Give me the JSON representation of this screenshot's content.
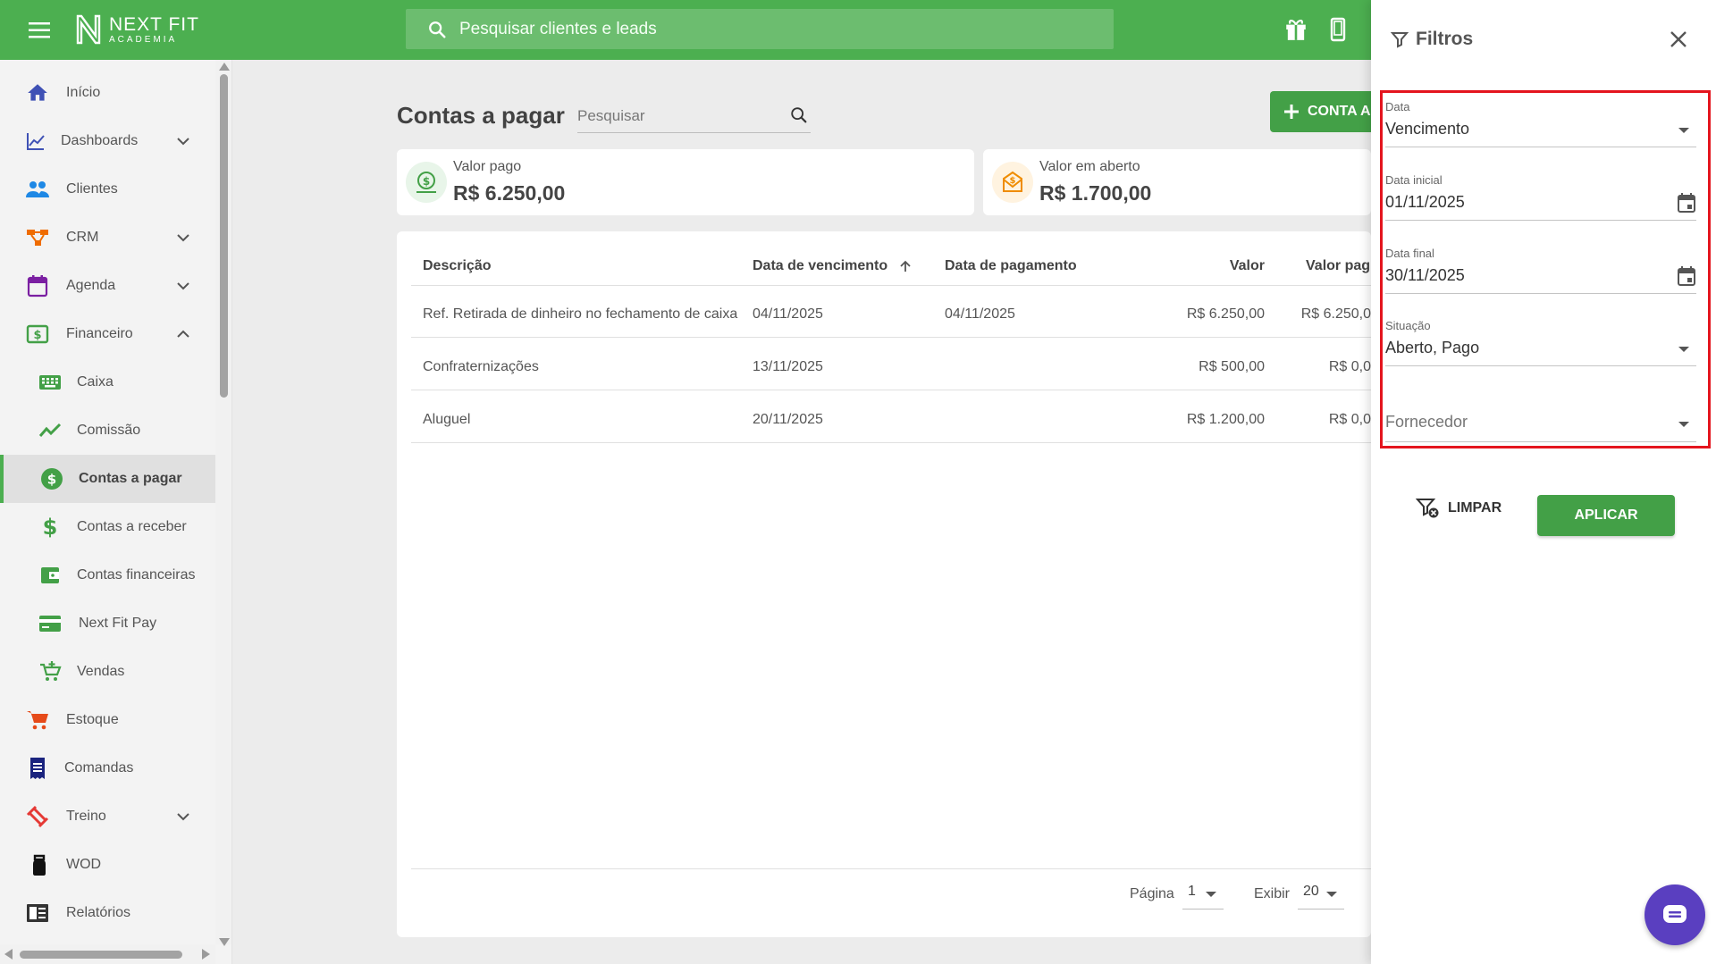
{
  "header": {
    "logo_line1": "NEXT FIT",
    "logo_line2": "ACADEMIA",
    "search_placeholder": "Pesquisar clientes e leads"
  },
  "sidebar": {
    "items": [
      {
        "label": "Início",
        "icon": "home-icon"
      },
      {
        "label": "Dashboards",
        "icon": "chart-line-icon",
        "expandable": true
      },
      {
        "label": "Clientes",
        "icon": "people-icon"
      },
      {
        "label": "CRM",
        "icon": "crm-icon",
        "expandable": true
      },
      {
        "label": "Agenda",
        "icon": "calendar-icon",
        "expandable": true
      },
      {
        "label": "Financeiro",
        "icon": "cash-icon",
        "expanded": true
      },
      {
        "label": "Caixa",
        "icon": "keyboard-icon",
        "sub": true
      },
      {
        "label": "Comissão",
        "icon": "trend-icon",
        "sub": true
      },
      {
        "label": "Contas a pagar",
        "icon": "dollar-circle-icon",
        "sub": true,
        "active": true
      },
      {
        "label": "Contas a receber",
        "icon": "dollar-icon",
        "sub": true
      },
      {
        "label": "Contas financeiras",
        "icon": "wallet-icon",
        "sub": true
      },
      {
        "label": "Next Fit Pay",
        "icon": "credit-card-icon",
        "sub": true
      },
      {
        "label": "Vendas",
        "icon": "cart-plus-icon",
        "sub": true
      },
      {
        "label": "Estoque",
        "icon": "cart-icon"
      },
      {
        "label": "Comandas",
        "icon": "receipt-icon"
      },
      {
        "label": "Treino",
        "icon": "dumbbell-icon",
        "expandable": true
      },
      {
        "label": "WOD",
        "icon": "kettlebell-icon"
      },
      {
        "label": "Relatórios",
        "icon": "report-icon"
      }
    ]
  },
  "main": {
    "title": "Contas a pagar",
    "search_placeholder": "Pesquisar",
    "add_button": "CONTA A",
    "summary": {
      "paid_label": "Valor pago",
      "paid_value": "R$ 6.250,00",
      "open_label": "Valor em aberto",
      "open_value": "R$ 1.700,00"
    },
    "table": {
      "headers": [
        "Descrição",
        "Data de vencimento",
        "Data de pagamento",
        "Valor",
        "Valor pag"
      ],
      "rows": [
        [
          "Ref. Retirada de dinheiro no fechamento de caixa",
          "04/11/2025",
          "04/11/2025",
          "R$ 6.250,00",
          "R$ 6.250,0"
        ],
        [
          "Confraternizações",
          "13/11/2025",
          "",
          "R$ 500,00",
          "R$ 0,0"
        ],
        [
          "Aluguel",
          "20/11/2025",
          "",
          "R$ 1.200,00",
          "R$ 0,0"
        ]
      ]
    },
    "pagination": {
      "page_label": "Página",
      "page_value": "1",
      "show_label": "Exibir",
      "show_value": "20"
    }
  },
  "filters": {
    "title": "Filtros",
    "fields": {
      "data": {
        "label": "Data",
        "value": "Vencimento"
      },
      "data_inicial": {
        "label": "Data inicial",
        "value": "01/11/2025"
      },
      "data_final": {
        "label": "Data final",
        "value": "30/11/2025"
      },
      "situacao": {
        "label": "Situação",
        "value": "Aberto, Pago"
      },
      "fornecedor": {
        "placeholder": "Fornecedor"
      }
    },
    "clear_label": "LIMPAR",
    "apply_label": "APLICAR"
  },
  "colors": {
    "primary": "#4caf50",
    "highlight": "#e4151e",
    "chat": "#5a3fc0"
  }
}
